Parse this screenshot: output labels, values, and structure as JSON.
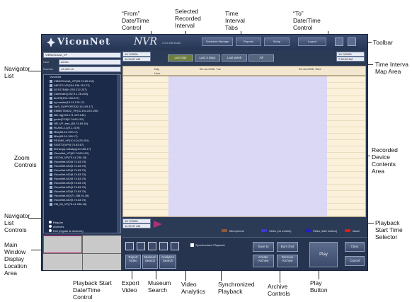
{
  "callouts": {
    "from_date": [
      "“From”",
      "Date/Time",
      "Control"
    ],
    "selected_interval": [
      "Selected",
      "Recorded",
      "Interval"
    ],
    "time_tabs": [
      "Time",
      "Interval",
      "Tabs"
    ],
    "to_date": [
      "“To”",
      "Date/Time",
      "Control"
    ],
    "toolbar": [
      "Toolbar"
    ],
    "time_interval_map": [
      "Time Interva",
      "Map Area"
    ],
    "navigator_list": [
      "Navigator",
      "List"
    ],
    "zoom_controls": [
      "Zoom",
      "Controls"
    ],
    "recorded_device": [
      "Recorded",
      "Device",
      "Contents",
      "Area"
    ],
    "navigator_controls": [
      "Navigator",
      "List",
      "Controls"
    ],
    "main_window": [
      "Main",
      "Window",
      "Display",
      "Location",
      "Area"
    ],
    "playback_start": [
      "Playback",
      "Start Time",
      "Selector"
    ],
    "playback_date": [
      "Playback Start",
      "Date/Time",
      "Control"
    ],
    "export_video": [
      "Export",
      "Video"
    ],
    "museum_search": [
      "Museum",
      "Search"
    ],
    "video_analytics": [
      "Video",
      "Analytics"
    ],
    "sync_playback": [
      "Synchronized",
      "Playback"
    ],
    "archive_controls": [
      "Archive",
      "Controls"
    ],
    "play_button": [
      "Play",
      "Button"
    ]
  },
  "app": {
    "logo": "ViconNet",
    "title": "NVR",
    "version": "v.1.0.200 build",
    "toolbar": {
      "schedule": "Schedule Manage",
      "reports": "Reports",
      "setup": "Setup",
      "logout": "Logout"
    },
    "site": {
      "name": "VIBN231A4A_VP",
      "user_label": "User",
      "user": "admin",
      "number_label": "Number",
      "number": "12.400.v.k"
    },
    "from_date": "11/ 9/2006",
    "from_time": "11:34:57 AM",
    "to_date": "11/ 9/2006",
    "to_time": "7:45:52 AM",
    "tabs": [
      "Last day",
      "Last 3 days",
      "Last week",
      "All"
    ],
    "map_labels": {
      "day": "Day",
      "hour": "Hour",
      "left_date": "08-Jul-2006, Tue",
      "right_date": "09-Jul-2006, Wed"
    },
    "navigator_root": "ViconNet",
    "navigator_items": [
      "VIBN231A4A_VP(63.74.63.112)",
      "AM1TG-VP(194.136.110.27)",
      "DCS17B8(H.255.212.207)",
      "Camera#1(192.9.1.26.228)",
      "dbd75(194.196.227)",
      "ey-mobile(10.19.178.17)",
      "DeS_SUPPORT(92.16.199.17)",
      "EMMETEMZ2_VP(11.194.223.195)",
      "idle-rig(194.171.129.142)",
      "genie(PC8(5.74.63.112)",
      "HR_VP_test_(63.74.63.16)",
      "Hl-A90-2-4(9.1.16.9)",
      "Mbc(63.10.199.17)",
      "Mbc(63.10.199.17)",
      "PE1680_VP(10.114.29.201)",
      "SIGET2(VP(9.74.63.67)",
      "techsupp-mdsapp(10.136.17)",
      "ViconNet_VP(63.74.63.112)",
      "VICON_VP(75.41.236.18)",
      "ViconNet-MD(9.74.63.75)",
      "ViconNet-MD(9.74.63.75)",
      "ViconNet-MD(9.74.63.75)",
      "ViconNet-MD(9.74.63.75)",
      "ViconNet-MD(9.74.63.75)",
      "ViconNet-MD(9.74.63.75)",
      "ViconNet-MD(9.74.63.75)",
      "ViconNet-MD(9.74.63.75)",
      "ViconNet-MD(71.258.91.38)",
      "ViconNet-MD(9.74.63.75)",
      "VM_Mt_VP(75.41.236.18)"
    ],
    "nav_controls": [
      "Regular",
      "Archives",
      "Exit (regular & archives)"
    ],
    "playback_date": "11/ 9/2006",
    "playback_time": "11:32:37 AM",
    "legend": [
      "Microphone",
      "Video (no motion)",
      "Video (with motion)",
      "Alarm"
    ],
    "legend_colors": [
      "#8a5a3a",
      "#3a3ad0",
      "#2020c0",
      "#d02020"
    ],
    "buttons": {
      "export": "Export Video",
      "museum": "Museum Search",
      "analytics": "Analytics Search",
      "sync": "Synchronized Playback",
      "save_to": "Save to",
      "burn": "Burn Dvd",
      "create": "Create Archive",
      "remove": "Remove Archive",
      "play": "Play",
      "clear": "Clear",
      "cancel": "Cancel"
    }
  }
}
